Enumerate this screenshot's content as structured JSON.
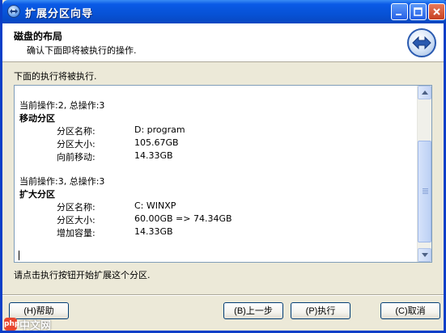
{
  "window": {
    "title": "扩展分区向导"
  },
  "header": {
    "title": "磁盘的布局",
    "subtitle": "确认下面即将被执行的操作."
  },
  "intro_text": "下面的执行将被执行.",
  "log": {
    "op1": {
      "status": "当前操作:2, 总操作:3",
      "name": "移动分区",
      "rows": [
        {
          "label": "分区名称:",
          "value": "D: program"
        },
        {
          "label": "分区大小:",
          "value": "105.67GB"
        },
        {
          "label": "向前移动:",
          "value": "14.33GB"
        }
      ]
    },
    "op2": {
      "status": "当前操作:3, 总操作:3",
      "name": "扩大分区",
      "rows": [
        {
          "label": "分区名称:",
          "value": "C: WINXP"
        },
        {
          "label": "分区大小:",
          "value": "60.00GB => 74.34GB"
        },
        {
          "label": "增加容量:",
          "value": "14.33GB"
        }
      ]
    }
  },
  "prompt_text": "请点击执行按钮开始扩展这个分区.",
  "buttons": {
    "help": "(H)帮助",
    "back": "(B)上一步",
    "execute": "(P)执行",
    "cancel": "(C)取消"
  },
  "watermark": {
    "text": "中文网",
    "badge": "php"
  },
  "colors": {
    "titlebar": "#0752d6",
    "dialog_bg": "#ece9d8",
    "border": "#7f9db9"
  }
}
